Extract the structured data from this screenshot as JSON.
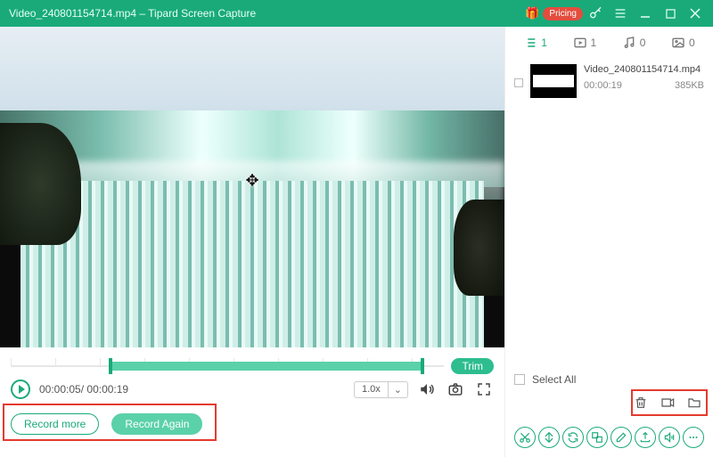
{
  "titlebar": {
    "filename": "Video_240801154714.mp4",
    "separator": "  –  ",
    "app_name": "Tipard Screen Capture",
    "pricing_label": "Pricing"
  },
  "timeline": {
    "trim_label": "Trim"
  },
  "playback": {
    "current": "00:00:05",
    "separator": "/ ",
    "duration": "00:00:19",
    "speed": "1.0x"
  },
  "record": {
    "more_label": "Record more",
    "again_label": "Record Again"
  },
  "library": {
    "tabs": {
      "list": "1",
      "video": "1",
      "audio": "0",
      "image": "0"
    },
    "item": {
      "name": "Video_240801154714.mp4",
      "duration": "00:00:19",
      "size": "385KB"
    },
    "select_all": "Select All"
  }
}
